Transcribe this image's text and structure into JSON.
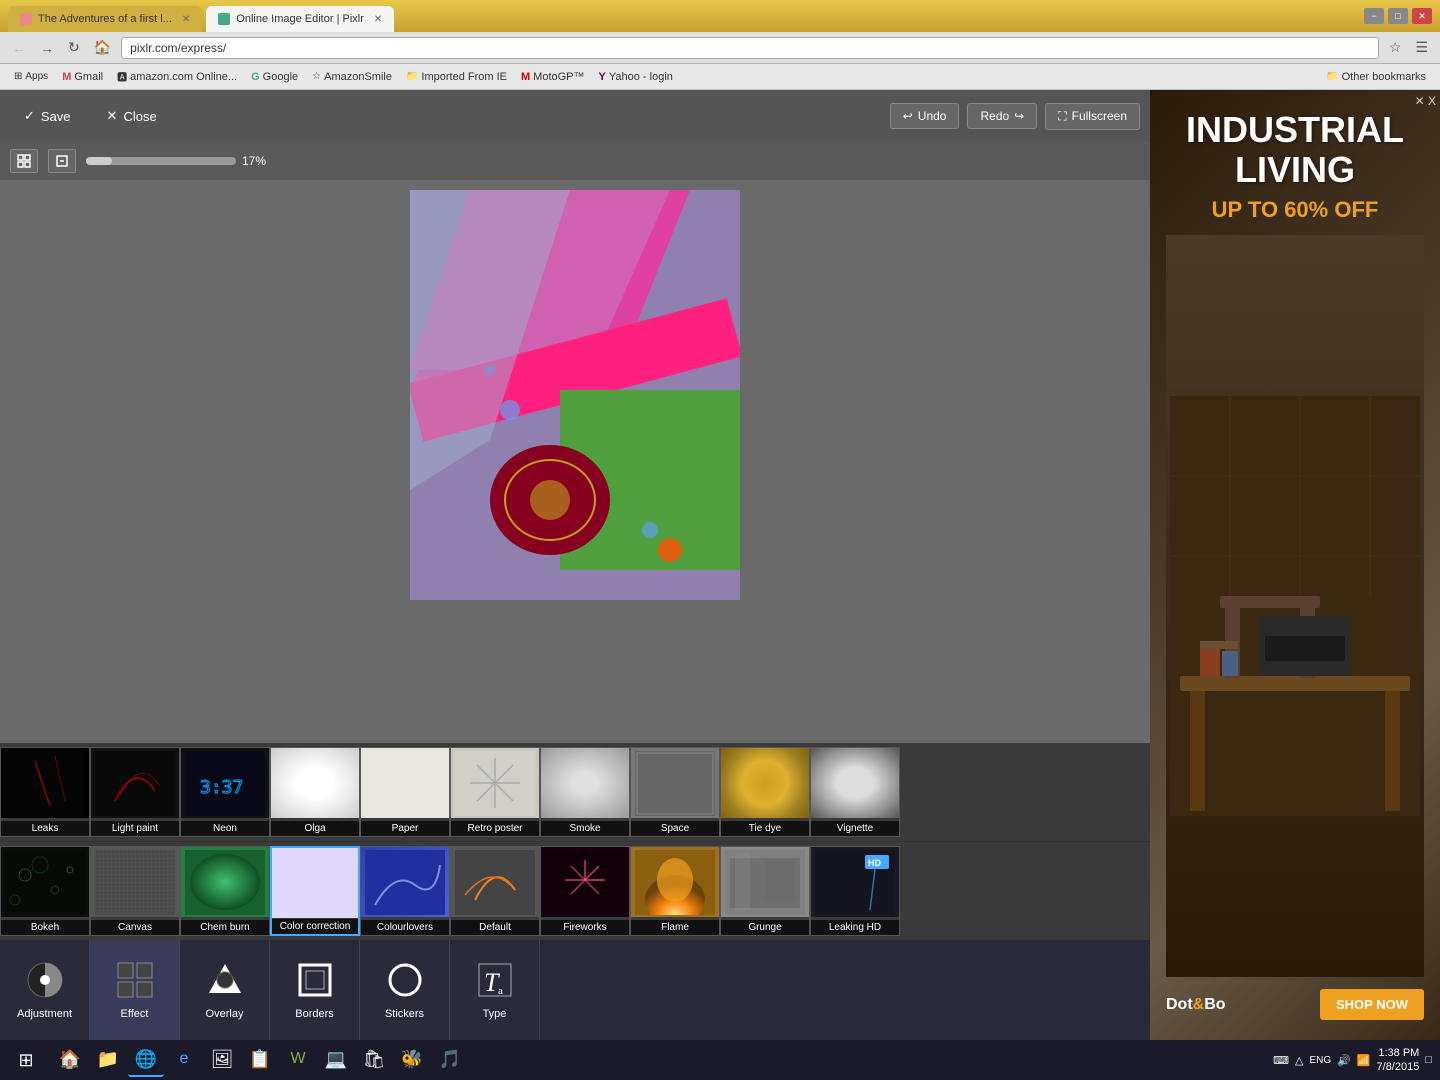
{
  "browser": {
    "tabs": [
      {
        "label": "The Adventures of a first l...",
        "icon": "🌐",
        "active": false
      },
      {
        "label": "Online Image Editor | Pixlr",
        "icon": "🖼",
        "active": true
      }
    ],
    "address": "pixlr.com/express/",
    "window_controls": [
      "−",
      "□",
      "✕"
    ]
  },
  "bookmarks": [
    {
      "label": "Apps",
      "icon": "⊞",
      "type": "apps"
    },
    {
      "label": "Gmail",
      "icon": "M",
      "color": "#c44"
    },
    {
      "label": "amazon.com Online...",
      "icon": "a",
      "color": "#f90"
    },
    {
      "label": "Google",
      "icon": "G",
      "color": "#4a8"
    },
    {
      "label": "AmazonSmile",
      "icon": "☆",
      "color": "#f90"
    },
    {
      "label": "Imported From IE",
      "icon": "📁",
      "color": "#fc0"
    },
    {
      "label": "MotoGP™",
      "icon": "M",
      "color": "#c00"
    },
    {
      "label": "Yahoo - login",
      "icon": "Y",
      "color": "#604"
    },
    {
      "label": "Other bookmarks",
      "icon": "📁",
      "color": "#fc0",
      "right": true
    }
  ],
  "toolbar": {
    "save_label": "Save",
    "close_label": "Close",
    "undo_label": "Undo",
    "redo_label": "Redo",
    "fullscreen_label": "Fullscreen",
    "zoom_value": "17%"
  },
  "effects_row1": [
    {
      "id": "leaks",
      "label": "Leaks",
      "bg": "#000",
      "color": "#222"
    },
    {
      "id": "lightpaint",
      "label": "Light paint",
      "bg": "#111",
      "color": "#811"
    },
    {
      "id": "neon",
      "label": "Neon",
      "bg": "#111",
      "color": "#44f"
    },
    {
      "id": "olga",
      "label": "Olga",
      "bg": "#ddd",
      "color": "#ddd"
    },
    {
      "id": "paper",
      "label": "Paper",
      "bg": "#e8e8e8",
      "color": "#e8e8e8"
    },
    {
      "id": "retroposter",
      "label": "Retro poster",
      "bg": "#ccc",
      "color": "#ccc"
    },
    {
      "id": "smoke",
      "label": "Smoke",
      "bg": "#bbb",
      "color": "#bbb"
    },
    {
      "id": "space",
      "label": "Space",
      "bg": "#888",
      "color": "#888"
    },
    {
      "id": "tiedye",
      "label": "Tie dye",
      "bg": "#c0a020",
      "color": "#c0a020"
    },
    {
      "id": "vignette",
      "label": "Vignette",
      "bg": "#aaa",
      "color": "#aaa"
    }
  ],
  "effects_row2": [
    {
      "id": "bokeh",
      "label": "Bokeh",
      "bg": "#0a1a0a",
      "color": "#0a1a0a"
    },
    {
      "id": "canvas",
      "label": "Canvas",
      "bg": "#555",
      "color": "#555"
    },
    {
      "id": "chemburn",
      "label": "Chem burn",
      "bg": "#208040",
      "color": "#208040"
    },
    {
      "id": "colorcorrection",
      "label": "Color correction",
      "bg": "#e0d0ff",
      "color": "#e0d0ff",
      "selected": true
    },
    {
      "id": "colourlovers",
      "label": "Colourlovers",
      "bg": "#3040b0",
      "color": "#3040b0"
    },
    {
      "id": "default",
      "label": "Default",
      "bg": "#555",
      "color": "#555"
    },
    {
      "id": "fireworks",
      "label": "Fireworks",
      "bg": "#200010",
      "color": "#200010"
    },
    {
      "id": "flame",
      "label": "Flame",
      "bg": "#a07020",
      "color": "#a07020"
    },
    {
      "id": "grunge",
      "label": "Grunge",
      "bg": "#888",
      "color": "#888"
    },
    {
      "id": "leakingHD",
      "label": "Leaking HD",
      "bg": "#222",
      "color": "#222"
    }
  ],
  "tools": [
    {
      "id": "adjustment",
      "label": "Adjustment",
      "icon": "◑"
    },
    {
      "id": "effect",
      "label": "Effect",
      "icon": "▦"
    },
    {
      "id": "overlay",
      "label": "Overlay",
      "icon": "✦"
    },
    {
      "id": "borders",
      "label": "Borders",
      "icon": "▢"
    },
    {
      "id": "stickers",
      "label": "Stickers",
      "icon": "◯"
    },
    {
      "id": "type",
      "label": "Type",
      "icon": "T"
    }
  ],
  "ad": {
    "title": "INDUSTRIAL\nLIVING",
    "subtitle": "UP TO 60% OFF",
    "logo": "Dot&Bo",
    "shop_btn": "SHOP NOW"
  },
  "taskbar": {
    "time": "1:38 PM",
    "date": "7/8/2015",
    "start_icon": "⊞",
    "apps": [
      "🏠",
      "📁",
      "🌐",
      "🔵",
      "🖼",
      "📋",
      "🎭",
      "💻",
      "📦",
      "🐝",
      "🔊"
    ]
  }
}
